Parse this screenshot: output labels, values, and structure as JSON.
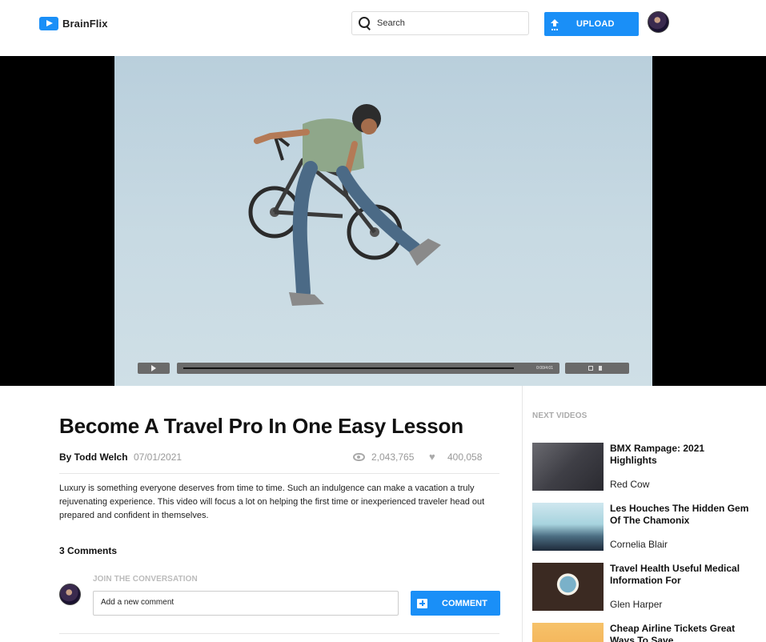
{
  "app": {
    "name": "BrainFlix"
  },
  "header": {
    "search": {
      "placeholder": "Search"
    },
    "upload_label": "UPLOAD"
  },
  "video": {
    "time": "0:00/4:01",
    "progress": 0
  },
  "details": {
    "title": "Become A Travel Pro In One Easy Lesson",
    "author": "By Todd Welch",
    "date": "07/01/2021",
    "views": "2,043,765",
    "likes": "400,058",
    "description": "Luxury is something everyone deserves from time to time. Such an indulgence can make a vacation a truly rejuvenating experience. This video will focus a lot on helping the first time or inexperienced traveler head out prepared and confident in themselves."
  },
  "comments": {
    "count_label": "3 Comments",
    "join_label": "JOIN THE CONVERSATION",
    "input_placeholder": "Add a new comment",
    "submit_label": "COMMENT"
  },
  "sidebar": {
    "heading": "NEXT VIDEOS",
    "items": [
      {
        "title": "BMX Rampage: 2021 Highlights",
        "channel": "Red Cow"
      },
      {
        "title": "Les Houches The Hidden Gem Of The Chamonix",
        "channel": "Cornelia Blair"
      },
      {
        "title": "Travel Health Useful Medical Information For",
        "channel": "Glen Harper"
      },
      {
        "title": "Cheap Airline Tickets Great Ways To Save",
        "channel": ""
      }
    ]
  },
  "colors": {
    "accent": "#1a8ff7"
  }
}
